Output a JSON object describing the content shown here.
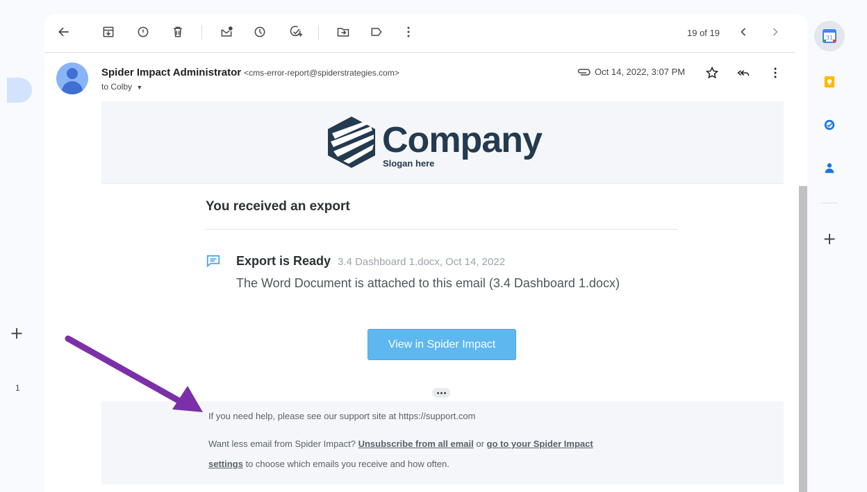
{
  "toolbar": {
    "count": "19 of 19",
    "icons": [
      "back-icon",
      "archive-icon",
      "report-spam-icon",
      "delete-icon",
      "mark-unread-icon",
      "snooze-icon",
      "add-task-icon",
      "move-to-icon",
      "label-icon",
      "more-vert-icon",
      "newer-icon",
      "older-icon"
    ]
  },
  "message": {
    "sender_name": "Spider Impact Administrator",
    "sender_email": "<cms-error-report@spiderstrategies.com>",
    "to": "to Colby",
    "date": "Oct 14, 2022, 3:07 PM"
  },
  "email": {
    "logo_word": "Company",
    "logo_slogan": "Slogan here",
    "title": "You received an export",
    "ready_title": "Export is Ready",
    "ready_meta": "3.4 Dashboard 1.docx, Oct 14, 2022",
    "ready_desc": "The Word Document is attached to this email (3.4 Dashboard 1.docx)",
    "cta_label": "View in Spider Impact",
    "footer": {
      "help": "If you need help, please see our support site at https://support.com",
      "less_prefix": "Want less email from Spider Impact?",
      "unsubscribe": "Unsubscribe from all email",
      "or": "or",
      "settings_link_1": "go to your Spider Impact",
      "settings_link_2": "settings",
      "suffix": "to choose which emails you receive and how often."
    }
  },
  "left_rail": {
    "count": "1"
  },
  "right_rail": {
    "calendar_day": "31"
  },
  "colors": {
    "accent": "#5eb7ef",
    "brand": "#233a4f",
    "arrow": "#7b2fa8"
  }
}
